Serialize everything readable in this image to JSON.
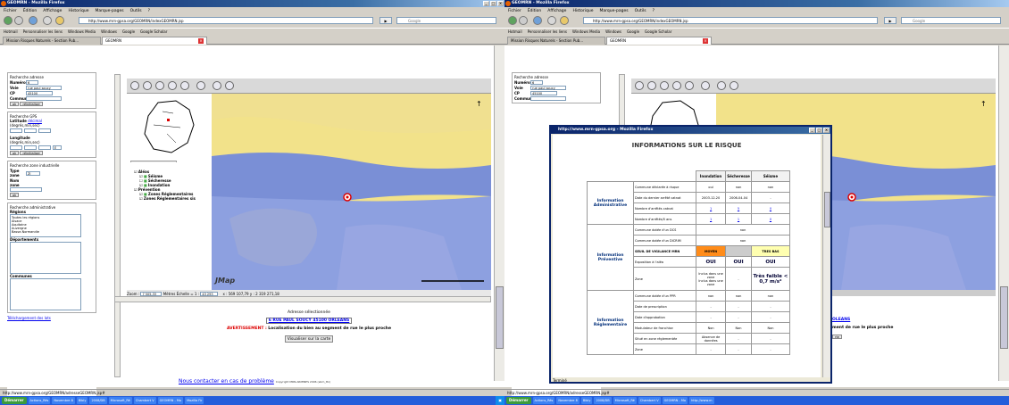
{
  "window": {
    "title": "GEOMRN - Mozilla Firefox",
    "btns": [
      "_",
      "□",
      "×"
    ]
  },
  "menu": [
    "Fichier",
    "Édition",
    "Affichage",
    "Historique",
    "Marque-pages",
    "Outils",
    "?"
  ],
  "nav": {
    "url": "http://www.mrn-gpsa.org/GEOMRN/indexGEOMRN.jsp",
    "search_placeholder": "Google"
  },
  "bookmarks": [
    "Hotmail",
    "Personnaliser les liens",
    "Windows Media",
    "Windows",
    "Google",
    "Google Scholar"
  ],
  "tabs": [
    "Mission Risques Naturels - Section Pub...",
    "GEOMRN"
  ],
  "sidebar": {
    "adresse": {
      "title": "Recherche adresse",
      "numero_label": "Numéro",
      "numero": "6",
      "voie_label": "Voie",
      "voie": "rue paul soucy",
      "cp_label": "CP",
      "cp": "45100",
      "commune_label": "Commune",
      "ok": "ok",
      "reinit": "réinitialiser"
    },
    "gps": {
      "title": "Recherche GPS",
      "lat_label": "Latitude",
      "lat_link": "décimal",
      "lat_hint": "(degrés,min,sec)",
      "lon_label": "Longitude",
      "lon_hint": "(degrés,min,sec)",
      "ok": "ok",
      "reinit": "réinitialiser"
    },
    "zone": {
      "title": "Recherche zone industrielle",
      "type_label": "Type zone",
      "type_val": "ZI",
      "nom_label": "Nom zone",
      "ok": "ok"
    },
    "admin": {
      "title": "Recherche administrative",
      "regions_label": "Régions",
      "regions": [
        "Toutes les régions",
        "Alsace",
        "Aquitaine",
        "Auvergne",
        "Basse-Normandie"
      ],
      "depts_label": "Départements",
      "communes_label": "Communes"
    },
    "telech": "Téléchargement des lots"
  },
  "legend": {
    "tab": "Hiérarchique",
    "items": [
      "Aléas",
      "Séisme",
      "Sécheresse",
      "Inondation",
      "Prévention",
      "Zones Réglementaires",
      "Zones Réglementaires sis"
    ]
  },
  "mapstatus": {
    "zoom_label": "Zoom :",
    "zoom": "7 505,33",
    "metres": "Mètres",
    "echelle_label": "Échelle = 1 :",
    "echelle": "43 293",
    "coords": "x : 569 107,79  y : 2 319 271,18",
    "brand": "JMap",
    "scale": [
      "0",
      "500",
      "1000",
      "1500 m"
    ]
  },
  "below": {
    "selected": "Adresse sélectionnée",
    "address": "6 RUE PAUL SOUCY 45100 ORLEANS",
    "warn_label": "AVERTISSEMENT :",
    "warn": "Localisation du bien au segment de rue le plus proche",
    "btn": "Visualiser sur la carte"
  },
  "contact": {
    "text": "Nous contacter en cas de problème",
    "copy": "Copyright MRN-ARMINES 2006 (ebm_ttn)"
  },
  "status": "http://www.mrn-gpsa.org/GEOMRN/adresseGEOMRN.jsp#",
  "taskbar": {
    "start": "Démarrer",
    "items": [
      "",
      "Actions_Rés",
      "Novembre 8",
      "Bibly",
      "2008/DB",
      "Microsoft_Ré",
      "Chambert V",
      "GEOMRN - Mo",
      "Mozilla Fir",
      "http://www.m"
    ],
    "clock": ""
  },
  "popup": {
    "title": "http://www.mrn-gpsa.org - Mozilla Firefox",
    "heading": "INFORMATIONS SUR LE RISQUE",
    "cols": [
      "Inondation",
      "Sécheresse",
      "Séisme"
    ],
    "sec1": "Information Administrative",
    "sec2": "Information Préventive",
    "sec3": "Information Réglementaire",
    "r1": [
      "Commune déclarée à risque",
      "oui",
      "non",
      "non"
    ],
    "r2": [
      "Date du dernier arrêté catnat",
      "2003-12-20",
      "2006-04-04",
      "-"
    ],
    "r3": [
      "Nombre d'arrêtés catnat",
      "1",
      "5",
      "0"
    ],
    "r4": [
      "Nombre d'arrêtés/5 ans",
      "1",
      "1",
      "0"
    ],
    "r5": [
      "Commune dotée d'un DCS",
      "non"
    ],
    "r6": [
      "Commune dotée d'un DICRIM",
      "non"
    ],
    "r7": [
      "SEUIL DE VIGILANCE MRN",
      "MOYEN",
      "",
      "TRES BAS"
    ],
    "r8": [
      "Exposition à l'aléa",
      "OUI",
      "OUI",
      "OUI"
    ],
    "r9": [
      "Zone",
      "Inclus dans une zone\nInclus dans une zone",
      "-",
      "Très faible < 0,7 m/s²"
    ],
    "r10": [
      "Commune dotée d'un PPR",
      "non",
      "non",
      "non"
    ],
    "r11": [
      "Date de prescription",
      "-",
      "-",
      "-"
    ],
    "r12": [
      "Date d'approbation",
      "-",
      "-",
      "-"
    ],
    "r13": [
      "Modulateur de franchise",
      "Non",
      "Non",
      "Non"
    ],
    "r14": [
      "Situé en zone réglementée",
      "Absence de données",
      "-",
      "-"
    ],
    "r15": [
      "Zone",
      "-",
      "-",
      "-"
    ],
    "status": "Terminé"
  },
  "right_peek": {
    "address": "OLEANS",
    "warn": "ment de rue le plus proche",
    "btn": "rte",
    "note": "ote"
  }
}
